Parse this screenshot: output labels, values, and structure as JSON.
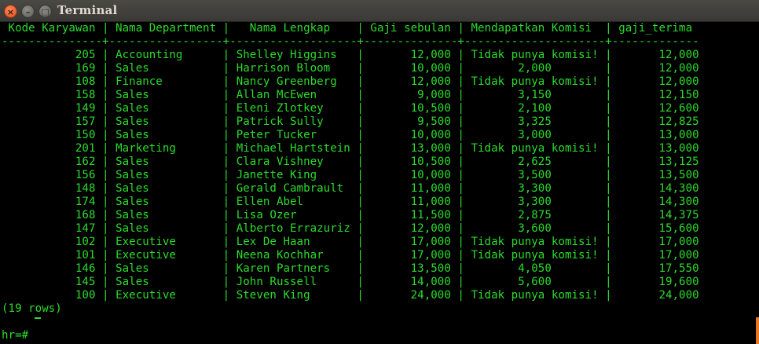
{
  "window": {
    "title": "Terminal"
  },
  "buttons": {
    "close": "×",
    "minimize": "–",
    "maximize": "□"
  },
  "colors": {
    "text": "#2bdc2b",
    "background": "#000000",
    "titlebar": "#3c3b37"
  },
  "header": " Kode Karyawan | Nama Department |   Nama Lengkap    | Gaji sebulan | Mendapatkan Komisi  | gaji_terima",
  "separator": "---------------+-----------------+-------------------+--------------+---------------------+-------------",
  "rows": [
    "           205 | Accounting      | Shelley Higgins   |       12,000 | Tidak punya komisi! |       12,000",
    "           169 | Sales           | Harrison Bloom    |       10,000 |        2,000        |       12,000",
    "           108 | Finance         | Nancy Greenberg   |       12,000 | Tidak punya komisi! |       12,000",
    "           158 | Sales           | Allan McEwen      |        9,000 |        3,150        |       12,150",
    "           149 | Sales           | Eleni Zlotkey     |       10,500 |        2,100        |       12,600",
    "           157 | Sales           | Patrick Sully     |        9,500 |        3,325        |       12,825",
    "           150 | Sales           | Peter Tucker      |       10,000 |        3,000        |       13,000",
    "           201 | Marketing       | Michael Hartstein |       13,000 | Tidak punya komisi! |       13,000",
    "           162 | Sales           | Clara Vishney     |       10,500 |        2,625        |       13,125",
    "           156 | Sales           | Janette King      |       10,000 |        3,500        |       13,500",
    "           148 | Sales           | Gerald Cambrault  |       11,000 |        3,300        |       14,300",
    "           174 | Sales           | Ellen Abel        |       11,000 |        3,300        |       14,300",
    "           168 | Sales           | Lisa Ozer         |       11,500 |        2,875        |       14,375",
    "           147 | Sales           | Alberto Errazuriz |       12,000 |        3,600        |       15,600",
    "           102 | Executive       | Lex De Haan       |       17,000 | Tidak punya komisi! |       17,000",
    "           101 | Executive       | Neena Kochhar     |       17,000 | Tidak punya komisi! |       17,000",
    "           146 | Sales           | Karen Partners    |       13,500 |        4,050        |       17,550",
    "           145 | Sales           | John Russell      |       14,000 |        5,600        |       19,600",
    "           100 | Executive       | Steven King       |       24,000 | Tidak punya komisi! |       24,000"
  ],
  "footer": "(19 rows)",
  "prompt": "hr=# "
}
